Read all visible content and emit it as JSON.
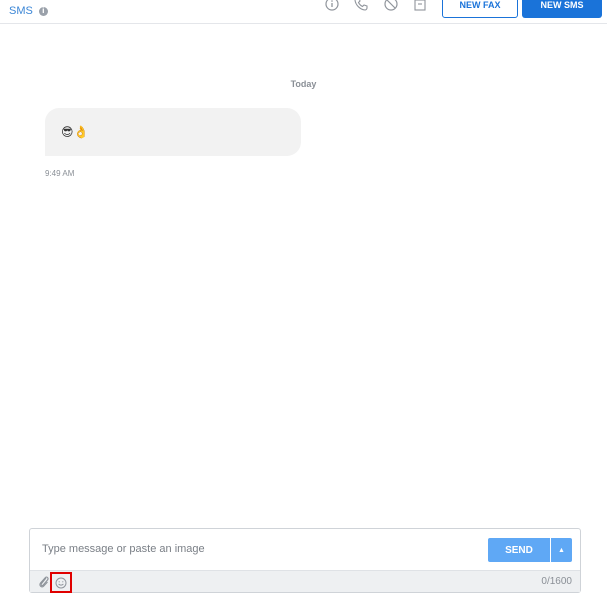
{
  "header": {
    "channel_label": "SMS",
    "info_badge": "i",
    "icons": [
      "info-icon",
      "phone-icon",
      "block-icon",
      "archive-icon"
    ],
    "new_fax_label": "NEW FAX",
    "new_sms_label": "NEW SMS"
  },
  "conversation": {
    "day_separator": "Today",
    "messages": [
      {
        "text": "😎👌",
        "time": "9:49 AM"
      }
    ]
  },
  "composer": {
    "placeholder": "Type message or paste an image",
    "send_label": "SEND",
    "send_caret": "▲",
    "char_counter": "0/1600"
  },
  "colors": {
    "accent": "#1a73d9",
    "send_button": "#5fa8f5",
    "highlight": "#e00000",
    "bubble": "#f2f2f2"
  }
}
